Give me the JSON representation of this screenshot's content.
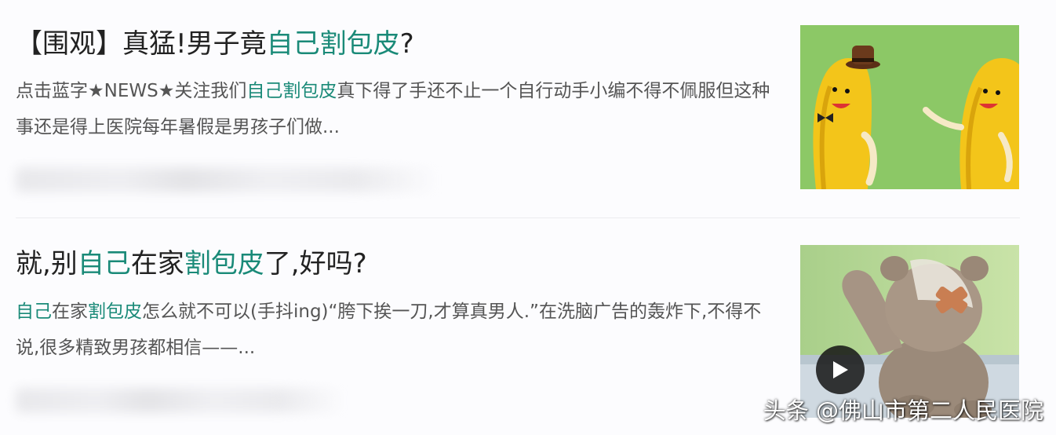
{
  "results": [
    {
      "title_parts": [
        {
          "text": "【围观】真猛!男子竟",
          "hl": false
        },
        {
          "text": "自己割包皮",
          "hl": true
        },
        {
          "text": "?",
          "hl": false
        }
      ],
      "snippet_parts": [
        {
          "text": "点击蓝字★NEWS★关注我们",
          "hl": false
        },
        {
          "text": "自己割包皮",
          "hl": true
        },
        {
          "text": "真下得了手还不止一个自行动手小编不得不佩服但这种事还是得上医院每年暑假是男孩子们做...",
          "hl": false
        }
      ]
    },
    {
      "title_parts": [
        {
          "text": "就,别",
          "hl": false
        },
        {
          "text": "自己",
          "hl": true
        },
        {
          "text": "在家",
          "hl": false
        },
        {
          "text": "割包皮",
          "hl": true
        },
        {
          "text": "了,好吗?",
          "hl": false
        }
      ],
      "snippet_parts": [
        {
          "text": "自己",
          "hl": true
        },
        {
          "text": "在家",
          "hl": false
        },
        {
          "text": "割包皮",
          "hl": true
        },
        {
          "text": "怎么就不可以(手抖ing)“胯下挨一刀,才算真男人.”在洗脑广告的轰炸下,不得不说,很多精致男孩都相信——...",
          "hl": false
        }
      ]
    }
  ],
  "watermark": "头条 @佛山市第二人民医院",
  "icons": [
    "play-icon"
  ],
  "colors": {
    "highlight": "#1a8a78",
    "text": "#222222",
    "snippet": "#555555"
  }
}
